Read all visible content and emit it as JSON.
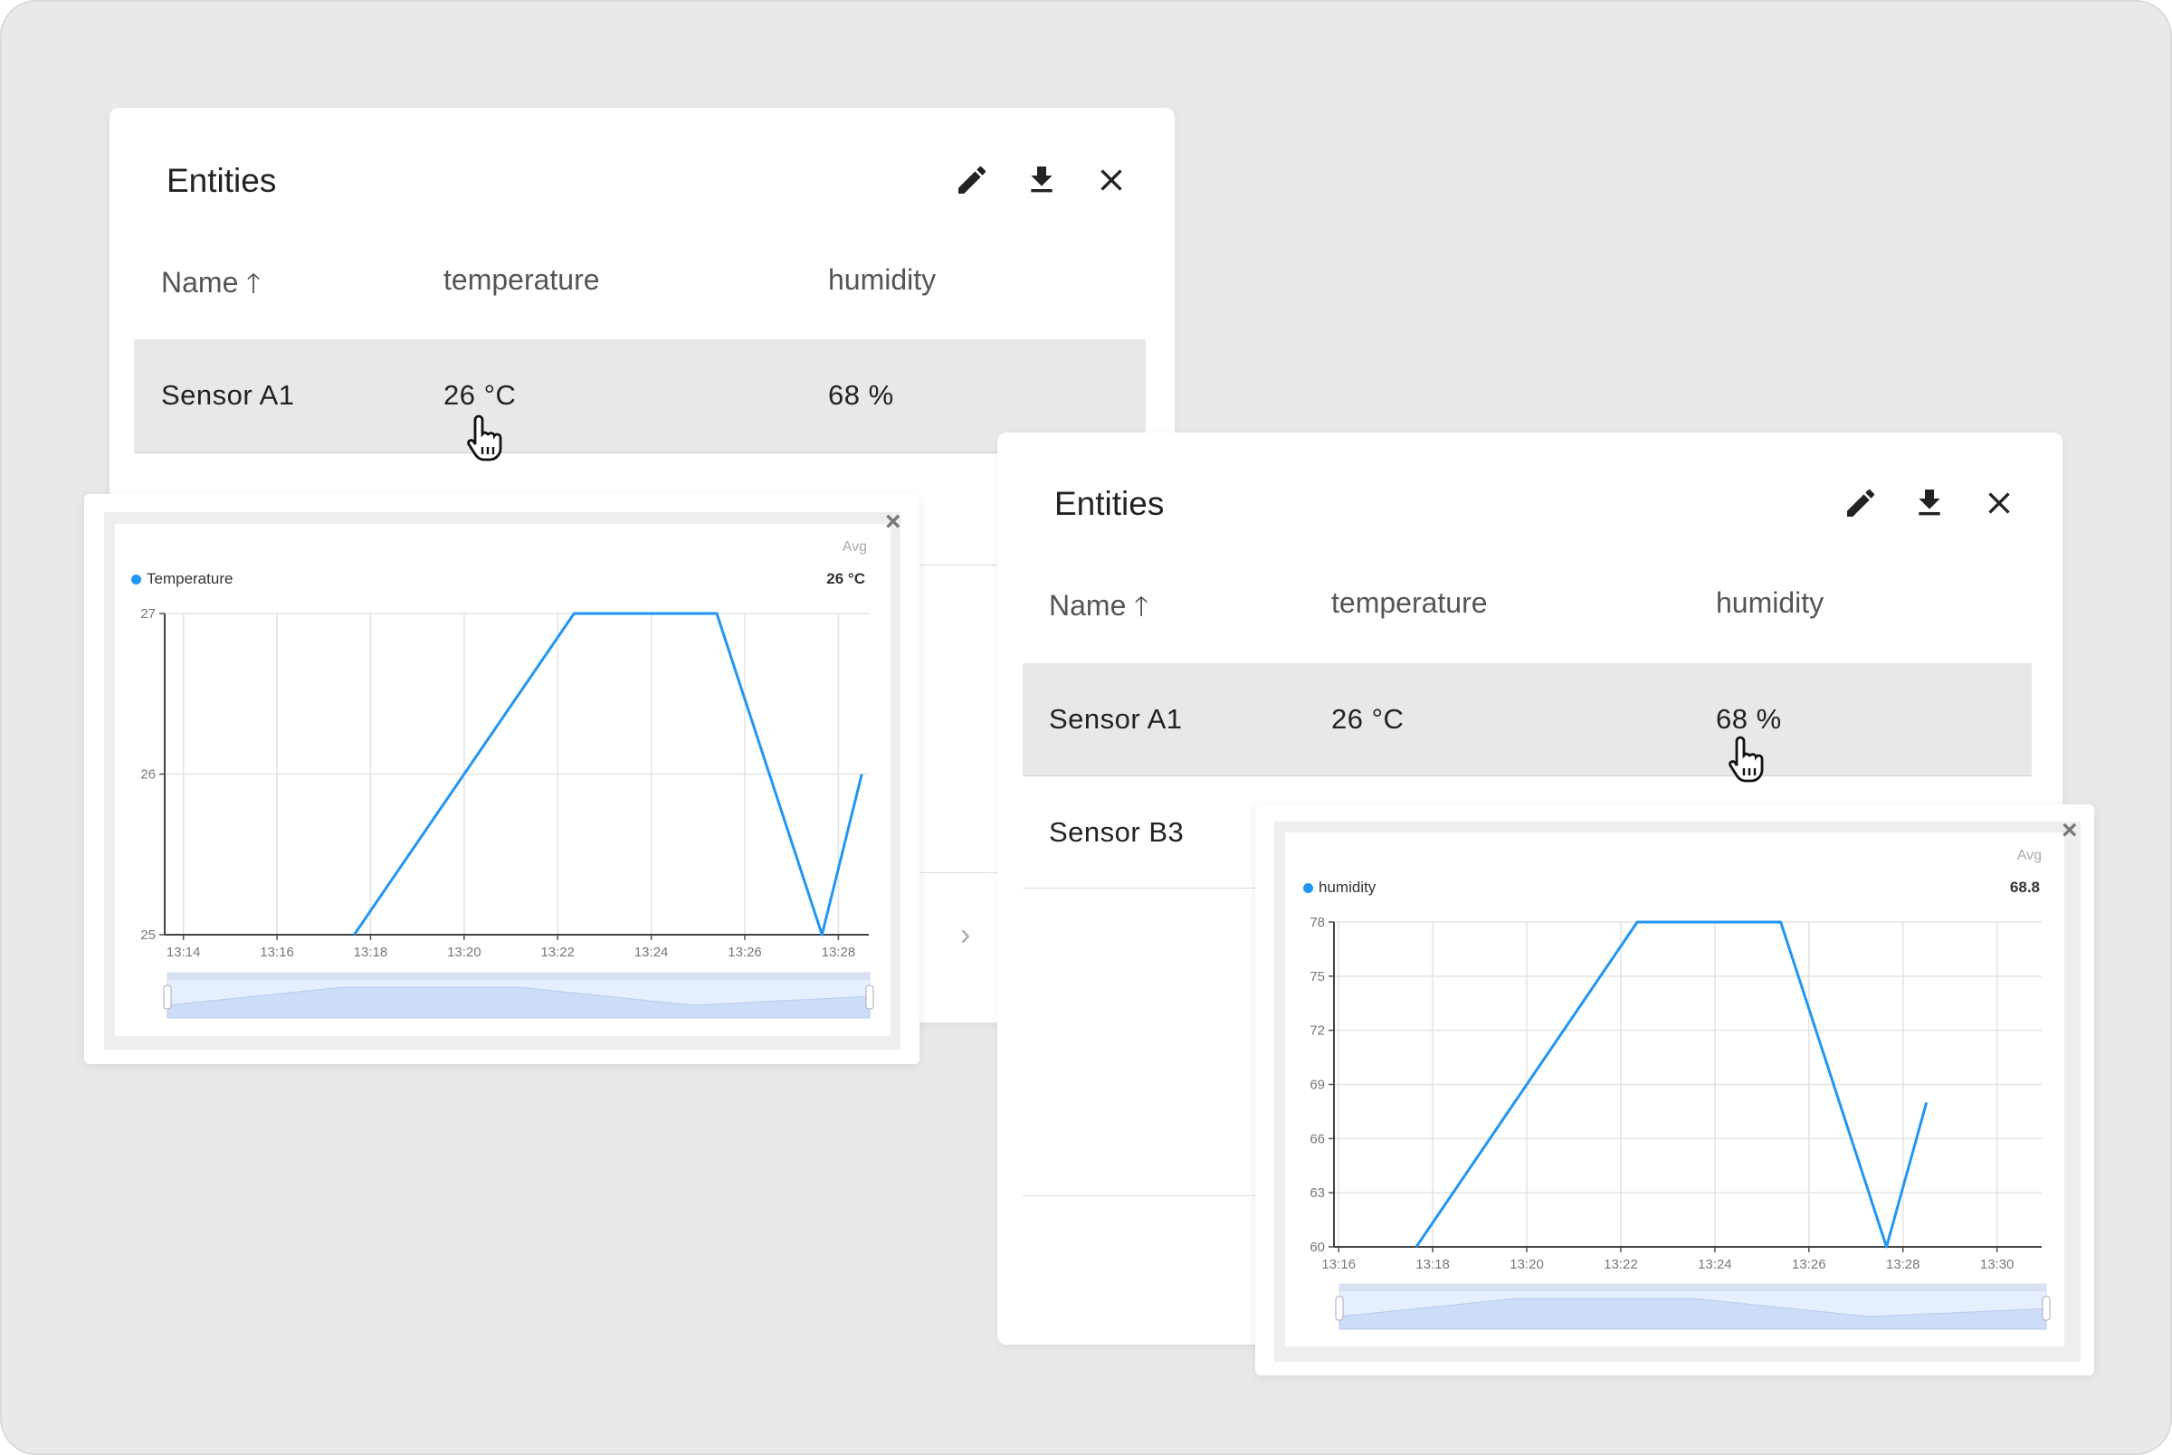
{
  "colors": {
    "accent": "#2196f3",
    "row_selected": "#e8e8e8",
    "background": "#e8e9eb"
  },
  "left_panel": {
    "title": "Entities",
    "toolbar": {
      "edit_icon": "pencil-icon",
      "download_icon": "download-icon",
      "close_icon": "close-icon"
    },
    "columns": [
      "Name",
      "temperature",
      "humidity"
    ],
    "sort_icon": "arrow-up-icon",
    "rows": [
      {
        "name": "Sensor A1",
        "temperature": "26 °C",
        "humidity": "68 %"
      }
    ],
    "pager_icon": "chevron-right-icon"
  },
  "right_panel": {
    "title": "Entities",
    "toolbar": {
      "edit_icon": "pencil-icon",
      "download_icon": "download-icon",
      "close_icon": "close-icon"
    },
    "columns": [
      "Name",
      "temperature",
      "humidity"
    ],
    "sort_icon": "arrow-up-icon",
    "rows": [
      {
        "name": "Sensor A1",
        "temperature": "26 °C",
        "humidity": "68 %"
      },
      {
        "name": "Sensor B3"
      }
    ]
  },
  "left_popup": {
    "close": "×",
    "avg_label": "Avg",
    "avg_value": "26 °C",
    "legend": "Temperature"
  },
  "right_popup": {
    "close": "×",
    "avg_label": "Avg",
    "avg_value": "68.8",
    "legend": "humidity"
  },
  "chart_data": [
    {
      "type": "line",
      "series": [
        {
          "name": "Temperature",
          "x": [
            "13:17:39",
            "13:22:21",
            "13:25:24",
            "13:27:39",
            "13:28:30"
          ],
          "y": [
            25,
            27,
            27,
            25,
            26
          ]
        }
      ],
      "xticks": [
        "13:14",
        "13:16",
        "13:18",
        "13:20",
        "13:22",
        "13:24",
        "13:26",
        "13:28"
      ],
      "yticks": [
        25,
        26,
        27
      ],
      "xlim": [
        "13:13:36",
        "13:28:39"
      ],
      "ylim": [
        25,
        27
      ],
      "grid": true,
      "color": "#2196f3"
    },
    {
      "type": "line",
      "series": [
        {
          "name": "humidity",
          "x": [
            "13:17:39",
            "13:22:21",
            "13:25:24",
            "13:27:39",
            "13:28:30"
          ],
          "y": [
            60,
            78,
            78,
            60,
            68
          ]
        }
      ],
      "xticks": [
        "13:16",
        "13:18",
        "13:20",
        "13:22",
        "13:24",
        "13:26",
        "13:28",
        "13:30"
      ],
      "yticks": [
        60,
        63,
        66,
        69,
        72,
        75,
        78
      ],
      "xlim": [
        "13:15:54",
        "13:30:57"
      ],
      "ylim": [
        60,
        78
      ],
      "grid": true,
      "color": "#2196f3"
    }
  ]
}
